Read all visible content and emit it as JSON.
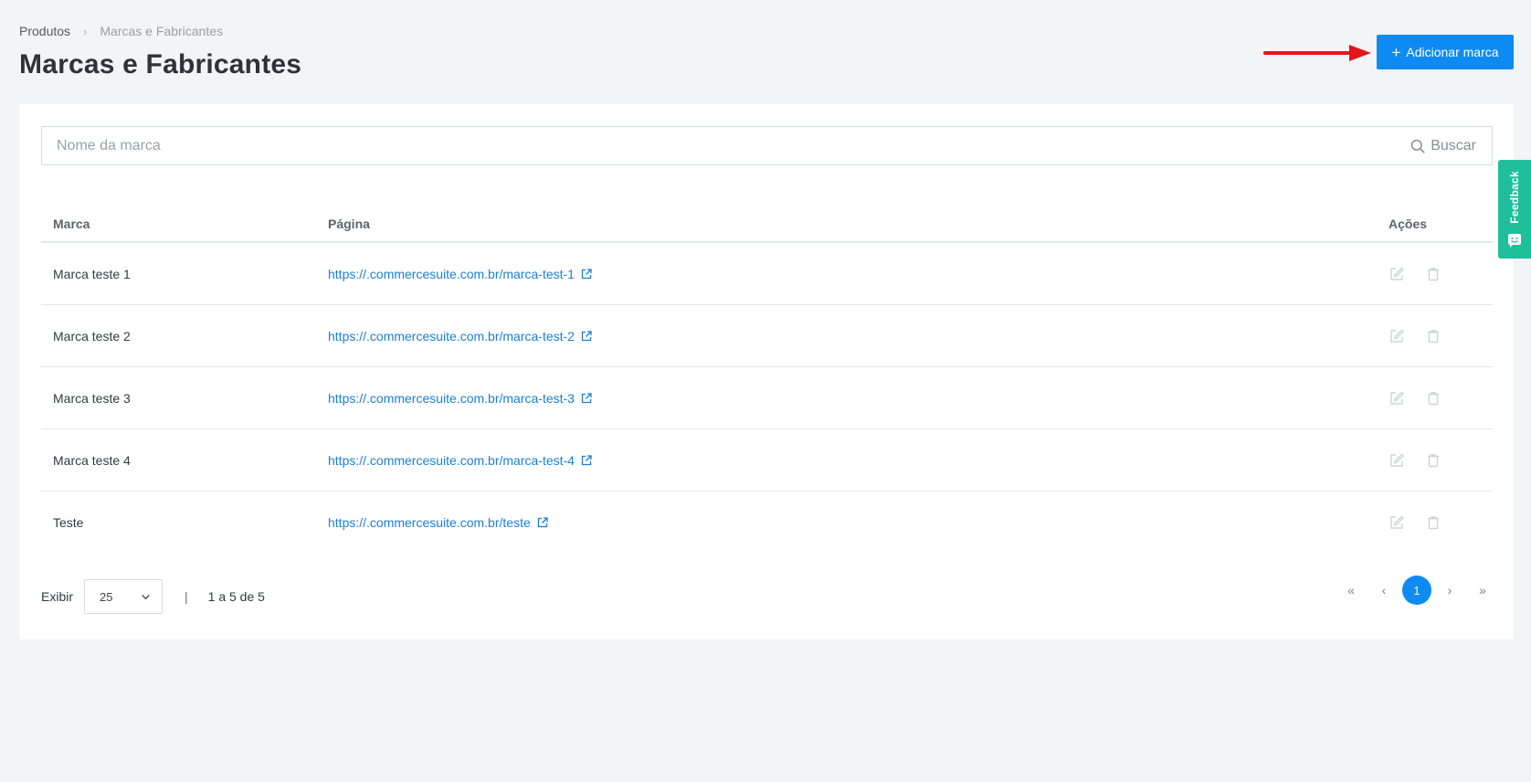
{
  "breadcrumb": {
    "root": "Produtos",
    "separator": "›",
    "current": "Marcas e Fabricantes"
  },
  "page_title": "Marcas e Fabricantes",
  "header": {
    "add_button_icon": "plus-icon",
    "add_button_label": "Adicionar marca"
  },
  "search": {
    "placeholder": "Nome da marca",
    "value": "",
    "button_label": "Buscar",
    "button_icon": "search-icon"
  },
  "table": {
    "columns": [
      "Marca",
      "Página",
      "Ações"
    ],
    "rows": [
      {
        "marca": "Marca teste 1",
        "pagina": "https://.commercesuite.com.br/marca-test-1"
      },
      {
        "marca": "Marca teste 2",
        "pagina": "https://.commercesuite.com.br/marca-test-2"
      },
      {
        "marca": "Marca teste 3",
        "pagina": "https://.commercesuite.com.br/marca-test-3"
      },
      {
        "marca": "Marca teste 4",
        "pagina": "https://.commercesuite.com.br/marca-test-4"
      },
      {
        "marca": "Teste",
        "pagina": "https://.commercesuite.com.br/teste"
      }
    ],
    "row_actions": [
      "edit-icon",
      "trash-icon"
    ]
  },
  "footer": {
    "show_label": "Exibir",
    "page_size": "25",
    "separator": "|",
    "range_text": "1 a 5 de 5"
  },
  "pagination": {
    "first": "«",
    "prev": "‹",
    "current_page": "1",
    "next": "›",
    "last": "»"
  },
  "feedback_tab": {
    "label": "Feedback",
    "icon": "smiley-chat-icon"
  },
  "colors": {
    "primary": "#0d8bf2",
    "link": "#1a7fd8",
    "feedback": "#1fbf9c",
    "annotation_arrow": "#e3161b"
  }
}
